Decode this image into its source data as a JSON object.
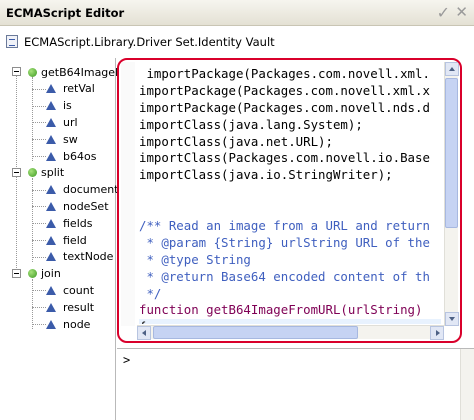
{
  "window": {
    "title": "ECMAScript Editor",
    "accept_icon": "check-icon",
    "close_icon": "close-icon"
  },
  "breadcrumb": {
    "icon": "policy-library-icon",
    "path": "ECMAScript.Library.Driver Set.Identity Vault"
  },
  "tree": {
    "functions": [
      {
        "name": "getB64ImageF",
        "params": [
          "retVal",
          "is",
          "url",
          "sw",
          "b64os"
        ]
      },
      {
        "name": "split",
        "params": [
          "document",
          "nodeSet",
          "fields",
          "field",
          "textNode"
        ]
      },
      {
        "name": "join",
        "params": [
          "count",
          "result",
          "node"
        ]
      }
    ]
  },
  "editor": {
    "lines": [
      {
        "cls": "",
        "text": " importPackage(Packages.com.novell.xml."
      },
      {
        "cls": "",
        "text": "importPackage(Packages.com.novell.xml.x"
      },
      {
        "cls": "",
        "text": "importPackage(Packages.com.novell.nds.d"
      },
      {
        "cls": "",
        "text": "importClass(java.lang.System);"
      },
      {
        "cls": "",
        "text": "importClass(java.net.URL);"
      },
      {
        "cls": "",
        "text": "importClass(Packages.com.novell.io.Base"
      },
      {
        "cls": "",
        "text": "importClass(java.io.StringWriter);"
      },
      {
        "cls": "",
        "text": ""
      },
      {
        "cls": "",
        "text": ""
      },
      {
        "cls": "cmt",
        "text": "/** Read an image from a URL and return"
      },
      {
        "cls": "cmt",
        "text": " * @param {String} urlString URL of the"
      },
      {
        "cls": "cmt",
        "text": " * @type String"
      },
      {
        "cls": "cmt",
        "text": " * @return Base64 encoded content of th"
      },
      {
        "cls": "cmt",
        "text": " */"
      },
      {
        "cls": "kw",
        "text": "function getB64ImageFromURL(urlString)"
      },
      {
        "cls": "",
        "text": "{"
      }
    ]
  },
  "console": {
    "prompt": ">"
  }
}
